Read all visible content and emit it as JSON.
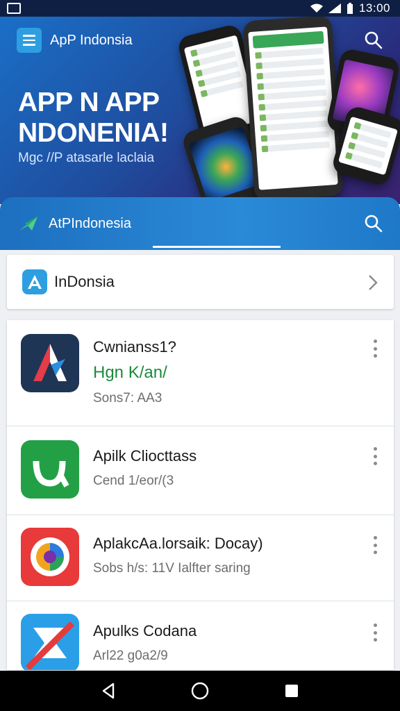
{
  "status": {
    "time": "13:00"
  },
  "hero": {
    "app_name": "ApP Indonsia",
    "title_line1": "APP N APP",
    "title_line2": "NDONENIA!",
    "subtitle": "Mgc //P atasarle laclaia"
  },
  "tabs": {
    "title": "AtPIndonesia"
  },
  "section": {
    "title": "InDonsia"
  },
  "apps": [
    {
      "name": "Cwnianss1?",
      "line2": "Hgn K/an/",
      "meta": "Sons7: AA3"
    },
    {
      "name": "Apilk Cliocttass",
      "meta": "Cend 1/eor/(3"
    },
    {
      "name": "AplakcAa.lorsaik: Docay)",
      "meta": "Sobs h/s: 11V Ialfter saring"
    },
    {
      "name": "Apulks Codana",
      "meta": "Arl22 g0a2/9"
    }
  ],
  "colors": {
    "status_bar": "#0f1f44",
    "tab_blue": "#1d6fbf",
    "accent_blue": "#2d9fe0",
    "green_text": "#1c8a3c"
  },
  "icons": [
    "menu-icon",
    "search-icon",
    "chevron-right-icon",
    "more-vert-icon",
    "back-icon",
    "home-icon",
    "recents-icon"
  ]
}
